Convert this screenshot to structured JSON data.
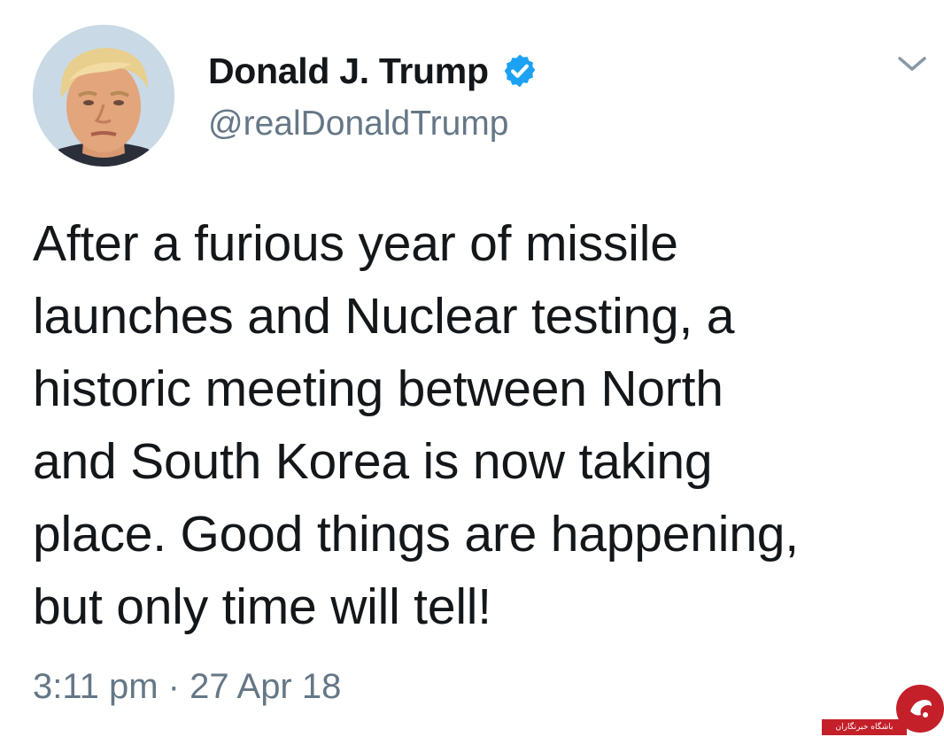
{
  "colors": {
    "text": "#14171a",
    "secondary": "#657786",
    "verified": "#1da1f2",
    "watermark": "#c3202a"
  },
  "tweet": {
    "author": {
      "display_name": "Donald J. Trump",
      "handle": "@realDonaldTrump",
      "verified_icon": "verified-badge-icon",
      "avatar_icon": "profile-photo"
    },
    "menu_icon": "chevron-down-icon",
    "text_lines": [
      "After a furious year of missile",
      "launches and Nuclear testing, a",
      "historic meeting between North",
      "and South Korea is now taking",
      "place. Good things are happening,",
      "but only time will tell!"
    ],
    "timestamp": "3:11 pm · 27 Apr 18"
  },
  "watermark": {
    "text": "باشگاه خبرنگاران",
    "logo_icon": "news-agency-logo-icon"
  }
}
